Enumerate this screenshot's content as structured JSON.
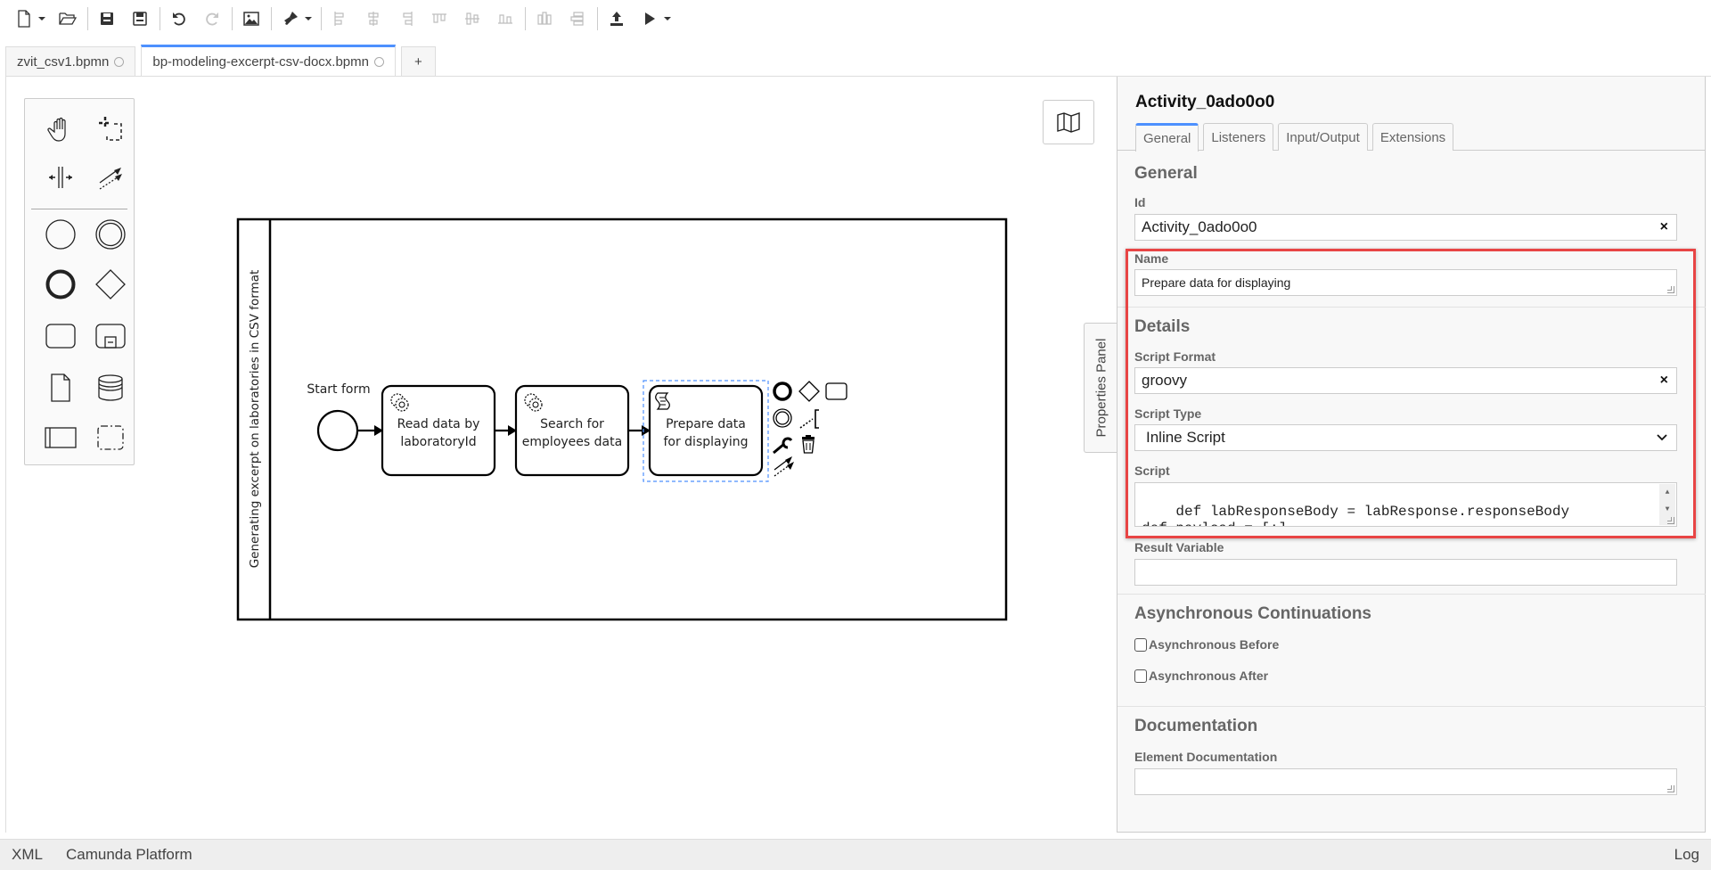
{
  "toolbar": {
    "items": [
      {
        "name": "new-file",
        "icon": "new-file-icon",
        "has_dropdown": true
      },
      {
        "name": "open-file",
        "icon": "folder-open-icon"
      },
      {
        "name": "save",
        "icon": "save-icon"
      },
      {
        "name": "save-as",
        "icon": "save-as-icon"
      },
      {
        "name": "undo",
        "icon": "undo-icon"
      },
      {
        "name": "redo",
        "icon": "redo-icon",
        "disabled": true
      },
      {
        "name": "export-image",
        "icon": "image-icon"
      },
      {
        "name": "color",
        "icon": "paint-brush-icon",
        "has_dropdown": true
      },
      {
        "name": "align-left",
        "icon": "align-left-icon",
        "disabled": true
      },
      {
        "name": "align-center",
        "icon": "align-center-icon",
        "disabled": true
      },
      {
        "name": "align-right",
        "icon": "align-right-icon",
        "disabled": true
      },
      {
        "name": "align-top",
        "icon": "align-top-icon",
        "disabled": true
      },
      {
        "name": "align-middle",
        "icon": "align-middle-icon",
        "disabled": true
      },
      {
        "name": "align-bottom",
        "icon": "align-bottom-icon",
        "disabled": true
      },
      {
        "name": "distribute-horizontal",
        "icon": "distribute-horizontal-icon",
        "disabled": true
      },
      {
        "name": "distribute-vertical",
        "icon": "distribute-vertical-icon",
        "disabled": true
      },
      {
        "name": "deploy",
        "icon": "deploy-icon"
      },
      {
        "name": "start-instance",
        "icon": "play-icon",
        "has_dropdown": true
      }
    ]
  },
  "tabs": [
    {
      "label": "zvit_csv1.bpmn",
      "active": false,
      "dirty_indicator": "circle"
    },
    {
      "label": "bp-modeling-excerpt-csv-docx.bpmn",
      "active": true,
      "dirty_indicator": "circle"
    },
    {
      "label": "+",
      "active": false
    }
  ],
  "palette": {
    "tools": [
      {
        "name": "hand-tool",
        "icon": "hand-icon"
      },
      {
        "name": "lasso-tool",
        "icon": "lasso-icon"
      },
      {
        "name": "space-tool",
        "icon": "space-tool-icon"
      },
      {
        "name": "global-connect-tool",
        "icon": "connect-icon"
      },
      {
        "name": "create-start-event",
        "icon": "start-event-icon"
      },
      {
        "name": "create-intermediate-event",
        "icon": "intermediate-event-icon"
      },
      {
        "name": "create-end-event",
        "icon": "end-event-icon"
      },
      {
        "name": "create-gateway",
        "icon": "gateway-icon"
      },
      {
        "name": "create-task",
        "icon": "task-icon"
      },
      {
        "name": "create-subprocess",
        "icon": "subprocess-icon"
      },
      {
        "name": "create-data-object",
        "icon": "data-object-icon"
      },
      {
        "name": "create-data-store",
        "icon": "data-store-icon"
      },
      {
        "name": "create-pool",
        "icon": "pool-icon"
      },
      {
        "name": "create-group",
        "icon": "group-icon"
      }
    ]
  },
  "diagram": {
    "pool_label": "Generating excerpt on laboratories in CSV format",
    "start_event_label": "Start form",
    "tasks": [
      {
        "type": "service",
        "lines": [
          "Read data by",
          "laboratoryId"
        ]
      },
      {
        "type": "service",
        "lines": [
          "Search for",
          "employees data"
        ]
      },
      {
        "type": "script",
        "lines": [
          "Prepare data",
          "for displaying"
        ],
        "selected": true
      }
    ],
    "context_pad": [
      "append-end-event",
      "append-gateway",
      "append-task",
      "append-intermediate-event",
      "append-text-annotation",
      "change-type",
      "delete",
      "connect"
    ]
  },
  "properties_toggle": "Properties Panel",
  "properties": {
    "title": "Activity_0ado0o0",
    "tabs": [
      "General",
      "Listeners",
      "Input/Output",
      "Extensions"
    ],
    "active_tab": "General",
    "general": {
      "section_title": "General",
      "id_label": "Id",
      "id_value": "Activity_0ado0o0",
      "name_label": "Name",
      "name_value": "Prepare data for displaying"
    },
    "details": {
      "section_title": "Details",
      "script_format_label": "Script Format",
      "script_format_value": "groovy",
      "script_type_label": "Script Type",
      "script_type_value": "Inline Script",
      "script_label": "Script",
      "script_value": "def labResponseBody = labResponse.responseBody\ndef payload = [:]",
      "result_variable_label": "Result Variable",
      "result_variable_value": ""
    },
    "async": {
      "section_title": "Asynchronous Continuations",
      "before_label": "Asynchronous Before",
      "before_checked": false,
      "after_label": "Asynchronous After",
      "after_checked": false
    },
    "documentation": {
      "section_title": "Documentation",
      "element_doc_label": "Element Documentation",
      "element_doc_value": ""
    },
    "clear_glyph": "×",
    "select_chevron": "⌄"
  },
  "statusbar": {
    "xml": "XML",
    "platform": "Camunda Platform",
    "log": "Log"
  },
  "colors": {
    "accent": "#4d90fe",
    "highlight": "#e84545",
    "selection": "#4d90fe"
  }
}
